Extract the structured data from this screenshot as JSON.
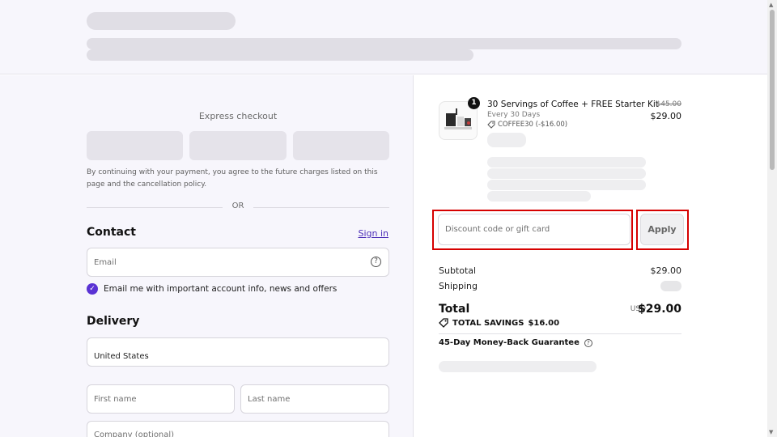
{
  "express": {
    "title": "Express checkout",
    "legal": "By continuing with your payment, you agree to the future charges listed on this page and the cancellation policy.",
    "or": "OR"
  },
  "contact": {
    "title": "Contact",
    "sign_in": "Sign in",
    "email_placeholder": "Email",
    "marketing_label": "Email me with important account info, news and offers",
    "marketing_checked": true
  },
  "delivery": {
    "title": "Delivery",
    "country": "United States",
    "first_name_placeholder": "First name",
    "last_name_placeholder": "Last name",
    "company_placeholder": "Company (optional)"
  },
  "order": {
    "quantity": "1",
    "product_title": "30 Servings of Coffee + FREE Starter Kit",
    "frequency": "Every 30 Days",
    "discount_code": "COFFEE30 (-$16.00)",
    "price_original": "$45.00",
    "price_final": "$29.00"
  },
  "discount": {
    "placeholder": "Discount code or gift card",
    "apply_label": "Apply"
  },
  "summary": {
    "subtotal_label": "Subtotal",
    "subtotal_value": "$29.00",
    "shipping_label": "Shipping",
    "total_label": "Total",
    "total_currency": "USD",
    "total_value": "$29.00",
    "savings_label": "TOTAL SAVINGS",
    "savings_value": "$16.00",
    "guarantee": "45-Day Money-Back Guarantee"
  },
  "colors": {
    "accent": "#5a32d4",
    "highlight": "#d60000"
  }
}
